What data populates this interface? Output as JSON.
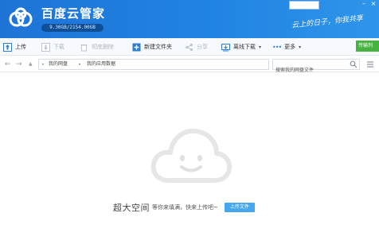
{
  "app": {
    "title": "百度云管家",
    "quota": "9.30GB/2154.00GB",
    "slogan": "云上的日子，你我共享"
  },
  "window_controls": {
    "minimize": "–",
    "close": "×"
  },
  "toolbar": {
    "upload": "上传",
    "download": "下载",
    "delete": "彻底删除",
    "new_folder": "新建文件夹",
    "share": "分享",
    "offline_download": "离线下载",
    "more": "更多",
    "transfer_list": "传输列"
  },
  "address": {
    "back": "←",
    "forward": "→",
    "up": "▲",
    "crumbs": [
      "我的网盘",
      "我的应用数据"
    ],
    "separator": "▸",
    "refresh": "⟳",
    "search_placeholder": "搜索我的网盘文件"
  },
  "empty_state": {
    "headline": "超大空间",
    "subtext": "等你来填满，快来上传吧~",
    "upload_button": "上传文件"
  },
  "colors": {
    "header": "#2083e2",
    "accent": "#45a8ee",
    "transfer": "#47b23f"
  }
}
